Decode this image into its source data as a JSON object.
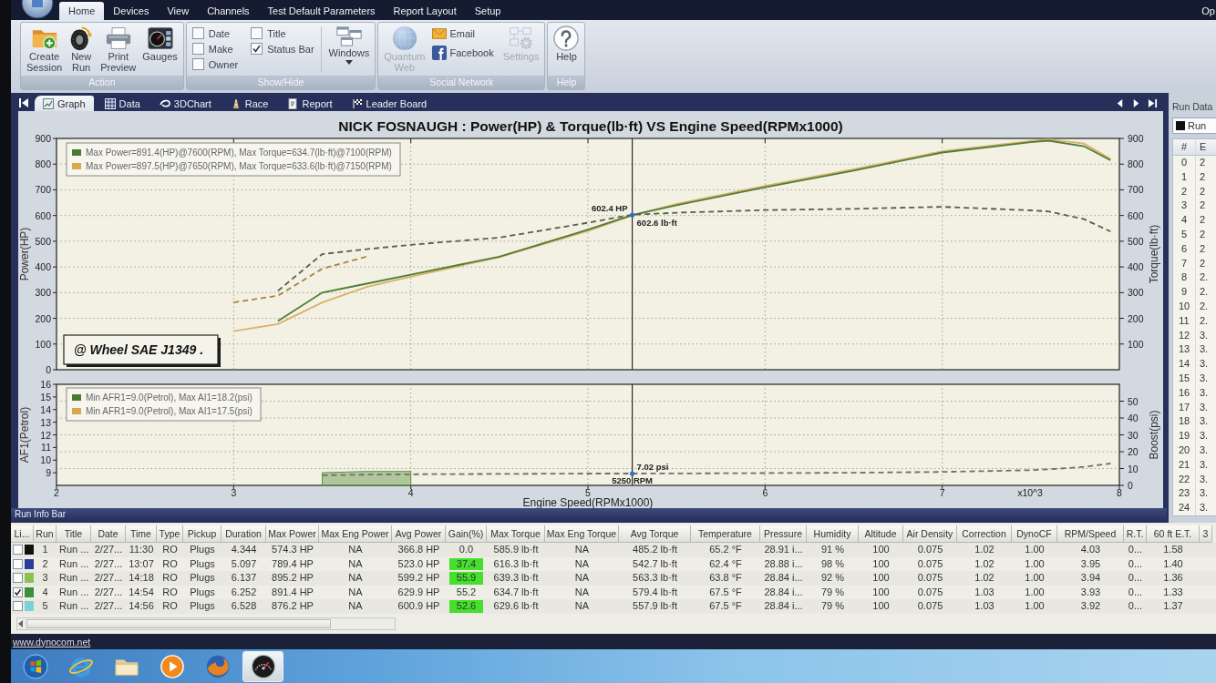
{
  "menu_bar": {
    "tabs": [
      {
        "label": "Home",
        "selected": true
      },
      {
        "label": "Devices",
        "selected": false
      },
      {
        "label": "View",
        "selected": false
      },
      {
        "label": "Channels",
        "selected": false
      },
      {
        "label": "Test Default Parameters",
        "selected": false
      },
      {
        "label": "Report Layout",
        "selected": false
      },
      {
        "label": "Setup",
        "selected": false
      }
    ],
    "cut_off_item": "Op"
  },
  "ribbon": {
    "groups": [
      {
        "kind": "action",
        "label": "Action",
        "buttons": [
          {
            "label": "Create Session"
          },
          {
            "label": "New Run"
          },
          {
            "label": "Print Preview"
          },
          {
            "label": "Gauges"
          }
        ]
      },
      {
        "kind": "show_hide",
        "label": "Show/Hide",
        "checkboxes": [
          {
            "label": "Date",
            "checked": false
          },
          {
            "label": "Title",
            "checked": false
          },
          {
            "label": "Make",
            "checked": false
          },
          {
            "label": "Status Bar",
            "checked": true
          },
          {
            "label": "Owner",
            "checked": false
          }
        ],
        "dropdown": {
          "label": "Windows"
        }
      },
      {
        "kind": "social",
        "label": "Social Network",
        "buttons": [
          {
            "kind": "large",
            "label": "Quantum Web",
            "disabled": true
          },
          {
            "kind": "small",
            "label": "Email",
            "disabled": false
          },
          {
            "kind": "small",
            "label": "Facebook",
            "disabled": false
          },
          {
            "kind": "large",
            "label": "Settings",
            "disabled": true
          }
        ]
      },
      {
        "kind": "help",
        "label": "Help",
        "buttons": [
          {
            "label": "Help"
          }
        ]
      }
    ]
  },
  "graph_panel": {
    "tabs": [
      {
        "label": "Graph",
        "selected": true
      },
      {
        "label": "Data",
        "selected": false
      },
      {
        "label": "3DChart",
        "selected": false
      },
      {
        "label": "Race",
        "selected": false
      },
      {
        "label": "Report",
        "selected": false
      },
      {
        "label": "Leader Board",
        "selected": false
      }
    ],
    "power_chart": {
      "chart_data": {
        "type": "line",
        "title": "NICK FOSNAUGH : Power(HP) & Torque(lb·ft) VS Engine Speed(RPMx1000)",
        "ylabel": "Power(HP)",
        "y2label": "Torque(lb·ft)",
        "x": [
          3.0,
          3.25,
          3.5,
          3.75,
          4.0,
          4.5,
          5.0,
          5.25,
          5.5,
          6.0,
          6.5,
          7.0,
          7.5,
          7.6,
          7.8,
          7.95
        ],
        "xlim": [
          2,
          8
        ],
        "ylim": [
          0,
          900
        ],
        "yticks": [
          0,
          100,
          200,
          300,
          400,
          500,
          600,
          700,
          800,
          900
        ],
        "y2lim": [
          0,
          900
        ],
        "y2ticks": [
          100,
          200,
          300,
          400,
          500,
          600,
          700,
          800,
          900
        ],
        "grid": true,
        "series": [
          {
            "color": "#d9b16c",
            "values": [
              150,
              178,
              262,
              322,
              362,
              438,
              540,
              600,
              645,
              715,
              780,
              850,
              890,
              896,
              880,
              820
            ]
          },
          {
            "color": "#a8823c",
            "line_style": "dashed",
            "values": [
              262,
              288,
              393,
              440,
              null,
              null,
              null,
              null,
              null,
              null,
              null,
              null,
              null,
              null,
              null,
              null
            ]
          },
          {
            "color": "#4f7d35",
            "values": [
              null,
              190,
              300,
              335,
              370,
              440,
              545,
              602,
              640,
              710,
              775,
              845,
              885,
              891,
              870,
              815
            ]
          },
          {
            "color": "#55604a",
            "line_style": "dashed",
            "values": [
              null,
              307,
              450,
              469,
              486,
              514,
              572,
              603,
              611,
              621,
              626,
              634,
              620,
              616,
              586,
              538
            ]
          }
        ],
        "ref_lines": [
          {
            "axis": "x",
            "value": 5.25
          }
        ],
        "annotations": [
          {
            "x": 5.25,
            "y": 602.4,
            "text": "602.4 HP"
          },
          {
            "x": 5.25,
            "y": 602.6,
            "text": "602.6 lb·ft"
          }
        ]
      },
      "legend": [
        {
          "text": "Max Power=891.4(HP)@7600(RPM), Max Torque=634.7(lb·ft)@7100(RPM)",
          "color": "#4a7a33"
        },
        {
          "text": "Max Power=897.5(HP)@7650(RPM), Max Torque=633.6(lb·ft)@7150(RPM)",
          "color": "#d8a84e"
        }
      ],
      "note": "@ Wheel SAE J1349 ."
    },
    "afr_chart": {
      "chart_data": {
        "type": "line",
        "xlabel": "Engine Speed(RPMx1000)",
        "ylabel": "AF1(Petrol)",
        "y2label": "Boost(psi)",
        "x": [
          3.5,
          3.75,
          4.0,
          4.5,
          5.0,
          5.25,
          5.5,
          6.0,
          6.5,
          7.0,
          7.5,
          7.6,
          7.8,
          7.95
        ],
        "xlim": [
          2,
          8
        ],
        "xticks": [
          2,
          3,
          4,
          5,
          6,
          7,
          8
        ],
        "ylim": [
          8,
          16
        ],
        "yticks": [
          9,
          10,
          11,
          12,
          13,
          14,
          15,
          16
        ],
        "y2lim": [
          0,
          60
        ],
        "y2ticks": [
          0,
          10,
          20,
          30,
          40,
          50
        ],
        "grid": true,
        "series": [
          {
            "type": "area",
            "color": "#5f9444",
            "values": [
              9.0,
              9.1,
              9.1,
              null,
              null,
              null,
              null,
              null,
              null,
              null,
              null,
              null,
              null,
              null
            ]
          },
          {
            "color": "#6f6f66",
            "axis": "y2",
            "line_style": "dashed",
            "values": [
              6.0,
              6.4,
              6.6,
              6.8,
              7.0,
              7.0,
              7.1,
              7.3,
              7.5,
              8.0,
              9.0,
              9.5,
              11.0,
              13.0
            ]
          }
        ],
        "ref_lines": [
          {
            "axis": "x",
            "value": 5.25
          }
        ],
        "annotations": [
          {
            "x": 5.25,
            "text": "7.02 psi"
          },
          {
            "x": 5.25,
            "text": "5250 RPM"
          }
        ]
      },
      "legend": [
        {
          "text": "Min AFR1=9.0(Petrol), Max AI1=18.2(psi)",
          "color": "#4a7a33"
        },
        {
          "text": "Min AFR1=9.0(Petrol), Max AI1=17.5(psi)",
          "color": "#d8a84e"
        }
      ],
      "x_multiplier_label": "x10^3"
    }
  },
  "run_data_panel": {
    "title": "Run Data",
    "run_selector": {
      "label": "Run",
      "color": "#111111"
    },
    "columns": [
      "#",
      "E"
    ],
    "rows": [
      [
        "0",
        "2"
      ],
      [
        "1",
        "2"
      ],
      [
        "2",
        "2"
      ],
      [
        "3",
        "2"
      ],
      [
        "4",
        "2"
      ],
      [
        "5",
        "2"
      ],
      [
        "6",
        "2"
      ],
      [
        "7",
        "2"
      ],
      [
        "8",
        "2."
      ],
      [
        "9",
        "2."
      ],
      [
        "10",
        "2."
      ],
      [
        "11",
        "2."
      ],
      [
        "12",
        "3."
      ],
      [
        "13",
        "3."
      ],
      [
        "14",
        "3."
      ],
      [
        "15",
        "3."
      ],
      [
        "16",
        "3."
      ],
      [
        "17",
        "3."
      ],
      [
        "18",
        "3."
      ],
      [
        "19",
        "3."
      ],
      [
        "20",
        "3."
      ],
      [
        "21",
        "3."
      ],
      [
        "22",
        "3."
      ],
      [
        "23",
        "3."
      ],
      [
        "24",
        "3."
      ]
    ]
  },
  "run_info_bar": {
    "title": "Run Info Bar"
  },
  "run_table": {
    "columns": [
      "Li...",
      "Run",
      "Title",
      "Date",
      "Time",
      "Type",
      "Pickup",
      "Duration",
      "Max Power",
      "Max Eng Power",
      "Avg Power",
      "Gain(%)",
      "Max Torque",
      "Max Eng Torque",
      "Avg Torque",
      "Temperature",
      "Pressure",
      "Humidity",
      "Altitude",
      "Air Density",
      "Correction",
      "DynoCF",
      "RPM/Speed",
      "R.T.",
      "60 ft E.T.",
      "3"
    ],
    "rows": [
      {
        "checked": false,
        "color": "#111111",
        "cells": [
          "",
          "1",
          "Run ...",
          "2/27...",
          "11:30",
          "RO",
          "Plugs",
          "4.344",
          "574.3 HP",
          "NA",
          "366.8 HP",
          {
            "text": "0.0",
            "highlighted": false
          },
          "585.9 lb·ft",
          "NA",
          "485.2 lb·ft",
          "65.2 °F",
          "28.91 i...",
          "91 %",
          "100",
          "0.075",
          "1.02",
          "1.00",
          "4.03",
          "0...",
          "1.58"
        ]
      },
      {
        "checked": false,
        "color": "#2b3d9c",
        "cells": [
          "",
          "2",
          "Run ...",
          "2/27...",
          "13:07",
          "RO",
          "Plugs",
          "5.097",
          "789.4 HP",
          "NA",
          "523.0 HP",
          {
            "text": "37.4",
            "highlighted": true
          },
          "616.3 lb·ft",
          "NA",
          "542.7 lb·ft",
          "62.4 °F",
          "28.88 i...",
          "98 %",
          "100",
          "0.075",
          "1.02",
          "1.00",
          "3.95",
          "0...",
          "1.40"
        ]
      },
      {
        "checked": false,
        "color": "#8cc152",
        "cells": [
          "",
          "3",
          "Run ...",
          "2/27...",
          "14:18",
          "RO",
          "Plugs",
          "6.137",
          "895.2 HP",
          "NA",
          "599.2 HP",
          {
            "text": "55.9",
            "highlighted": true
          },
          "639.3 lb·ft",
          "NA",
          "563.3 lb·ft",
          "63.8 °F",
          "28.84 i...",
          "92 %",
          "100",
          "0.075",
          "1.02",
          "1.00",
          "3.94",
          "0...",
          "1.36"
        ]
      },
      {
        "checked": true,
        "color": "#3d8f3d",
        "cells": [
          "",
          "4",
          "Run ...",
          "2/27...",
          "14:54",
          "RO",
          "Plugs",
          "6.252",
          "891.4 HP",
          "NA",
          "629.9 HP",
          {
            "text": "55.2",
            "highlighted": false
          },
          "634.7 lb·ft",
          "NA",
          "579.4 lb·ft",
          "67.5 °F",
          "28.84 i...",
          "79 %",
          "100",
          "0.075",
          "1.03",
          "1.00",
          "3.93",
          "0...",
          "1.33"
        ]
      },
      {
        "checked": false,
        "color": "#7ad3d6",
        "cells": [
          "",
          "5",
          "Run ...",
          "2/27...",
          "14:56",
          "RO",
          "Plugs",
          "6.528",
          "876.2 HP",
          "NA",
          "600.9 HP",
          {
            "text": "52.6",
            "highlighted": true
          },
          "629.6 lb·ft",
          "NA",
          "557.9 lb·ft",
          "67.5 °F",
          "28.84 i...",
          "79 %",
          "100",
          "0.075",
          "1.03",
          "1.00",
          "3.92",
          "0...",
          "1.37"
        ]
      }
    ]
  },
  "status_bar": {
    "link": "www.dynocom.net"
  },
  "taskbar": {
    "apps": [
      {
        "selected": false
      },
      {
        "selected": false
      },
      {
        "selected": false
      },
      {
        "selected": false
      },
      {
        "selected": false
      },
      {
        "selected": true
      }
    ]
  }
}
